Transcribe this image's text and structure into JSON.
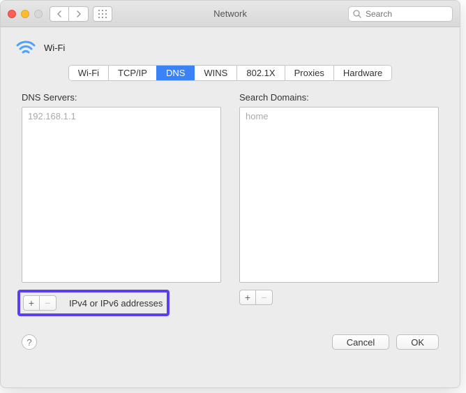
{
  "window_title": "Network",
  "search_placeholder": "Search",
  "connection_name": "Wi-Fi",
  "tabs": [
    "Wi-Fi",
    "TCP/IP",
    "DNS",
    "WINS",
    "802.1X",
    "Proxies",
    "Hardware"
  ],
  "active_tab_index": 2,
  "dns": {
    "label": "DNS Servers:",
    "items": [
      "192.168.1.1"
    ],
    "hint": "IPv4 or IPv6 addresses"
  },
  "search_domains": {
    "label": "Search Domains:",
    "items": [
      "home"
    ]
  },
  "buttons": {
    "cancel": "Cancel",
    "ok": "OK"
  }
}
